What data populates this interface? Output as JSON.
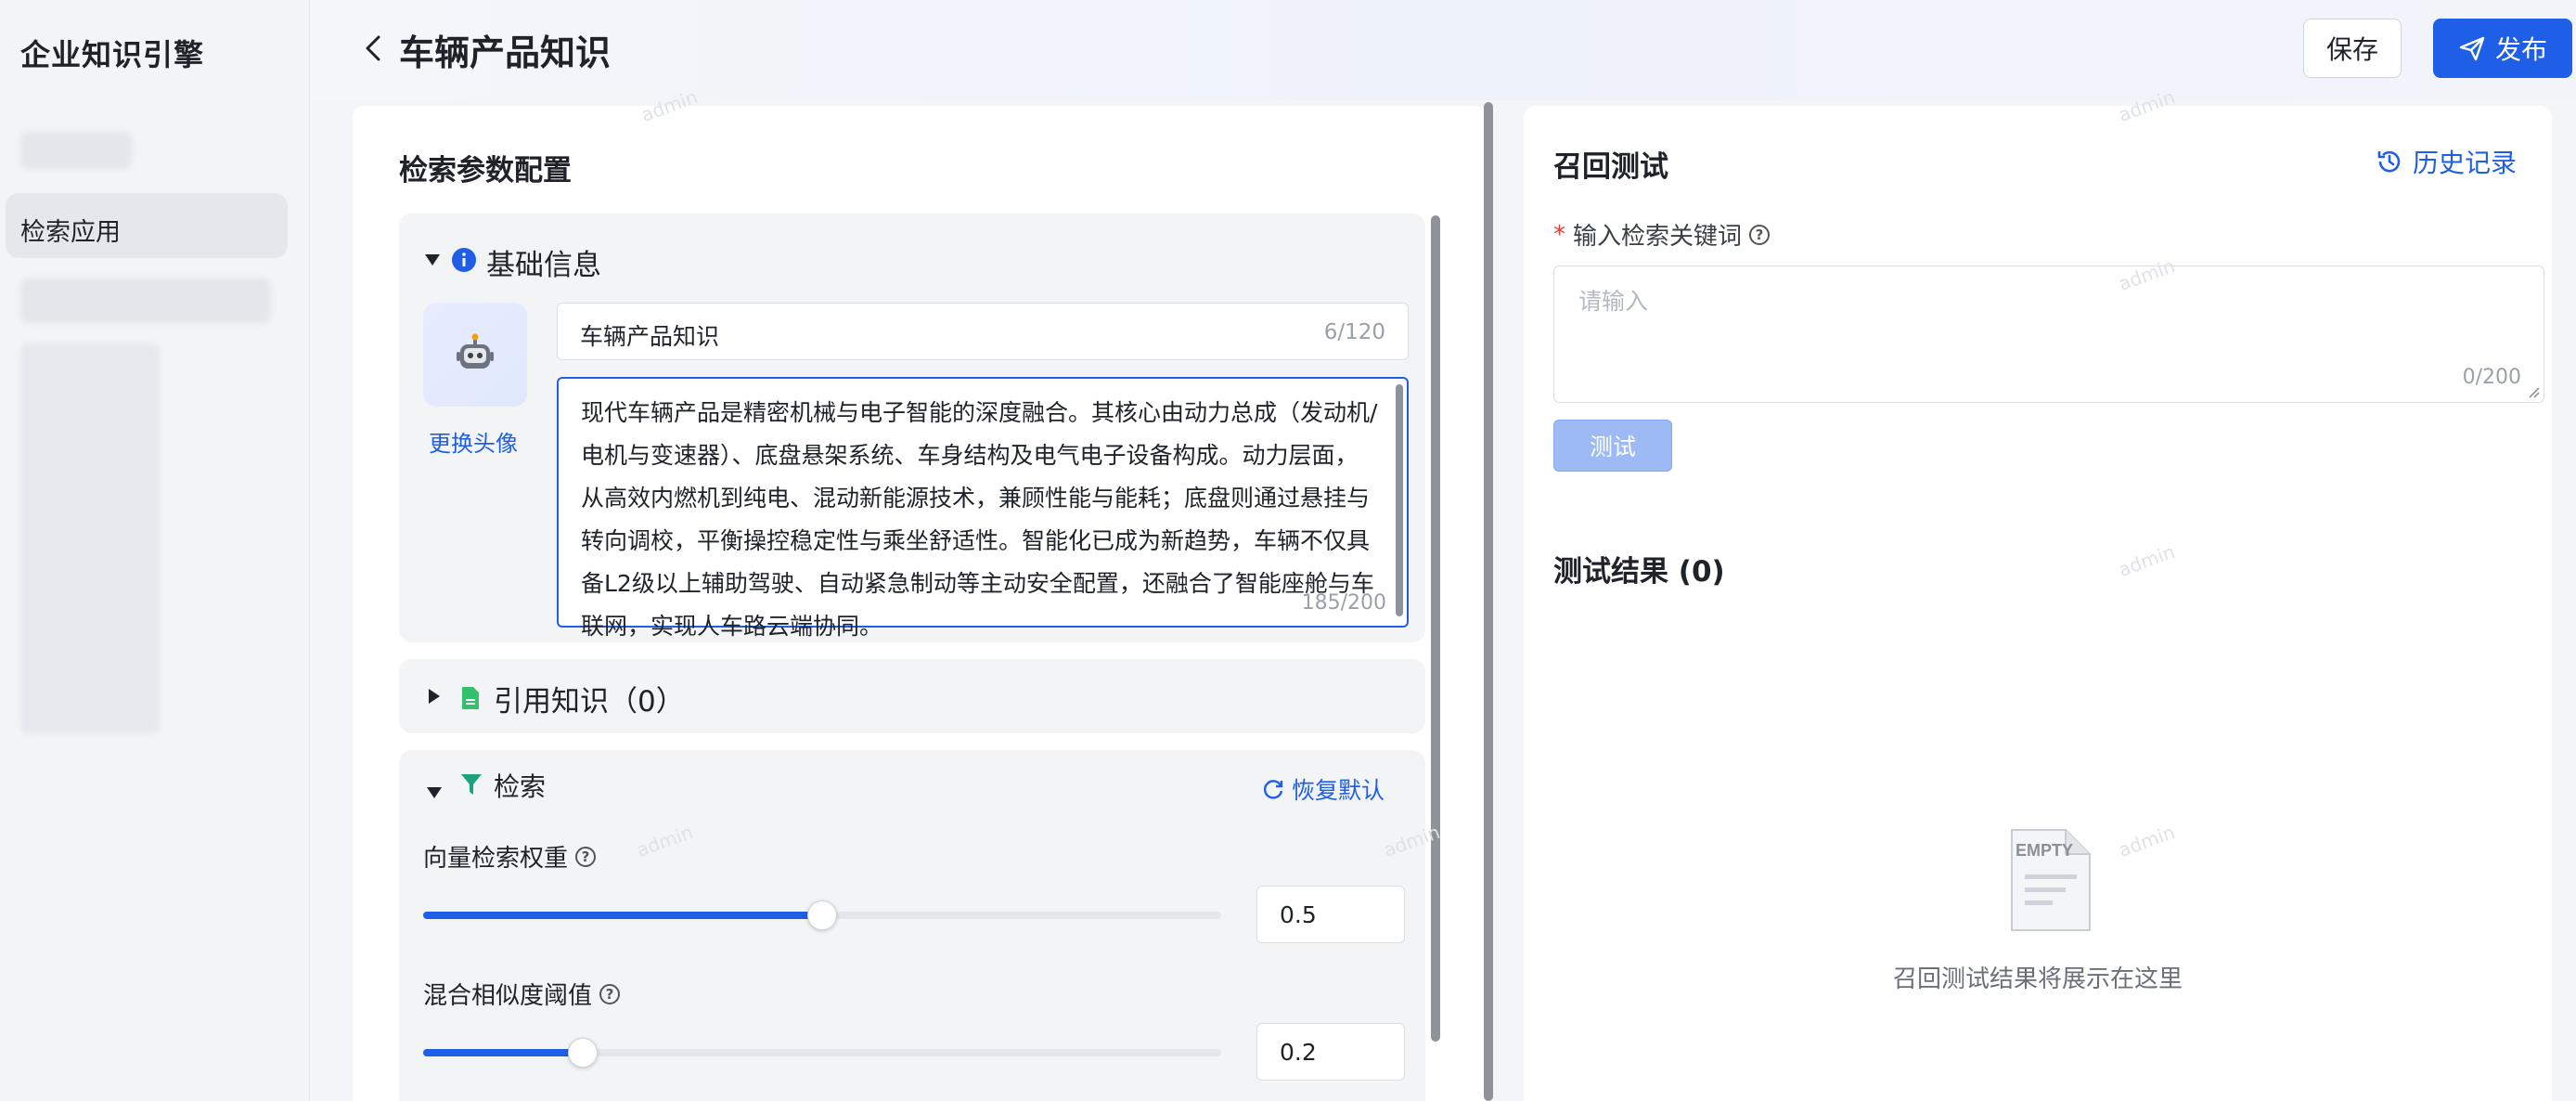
{
  "sidebar": {
    "brand": "企业知识引擎",
    "active_item": "检索应用"
  },
  "header": {
    "title": "车辆产品知识",
    "save_label": "保存",
    "publish_label": "发布"
  },
  "config": {
    "title": "检索参数配置",
    "basic": {
      "label": "基础信息",
      "change_avatar": "更换头像",
      "name_value": "车辆产品知识",
      "name_count": "6/120",
      "description": "现代车辆产品是精密机械与电子智能的深度融合。其核心由动力总成（发动机/电机与变速器）、底盘悬架系统、车身结构及电气电子设备构成。动力层面，从高效内燃机到纯电、混动新能源技术，兼顾性能与能耗；底盘则通过悬挂与转向调校，平衡操控稳定性与乘坐舒适性。智能化已成为新趋势，车辆不仅具备L2级以上辅助驾驶、自动紧急制动等主动安全配置，还融合了智能座舱与车联网，实现人车路云端协同。",
      "description_count": "185/200"
    },
    "reference": {
      "label": "引用知识（0）"
    },
    "search": {
      "label": "检索",
      "reset_label": "恢复默认",
      "vector_weight_label": "向量检索权重",
      "vector_weight_value": "0.5",
      "vector_weight_fraction": 0.5,
      "similarity_label": "混合相似度阈值",
      "similarity_value": "0.2",
      "similarity_fraction": 0.2
    }
  },
  "test": {
    "title": "召回测试",
    "history_label": "历史记录",
    "keyword_required": "*",
    "keyword_label": "输入检索关键词",
    "keyword_placeholder": "请输入",
    "keyword_count": "0/200",
    "test_button": "测试",
    "result_title": "测试结果 (0)",
    "empty_icon_label": "EMPTY",
    "empty_text": "召回测试结果将展示在这里"
  },
  "watermark": "admin",
  "colors": {
    "primary": "#1f5ee6",
    "disabled_primary": "#9dbaf5",
    "required": "#e3413b"
  }
}
